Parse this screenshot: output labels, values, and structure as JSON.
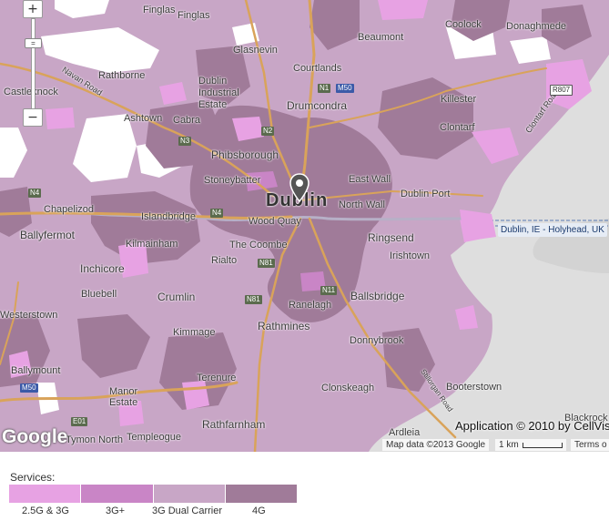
{
  "map": {
    "city_label": "Dublin",
    "districts": [
      "Finglas",
      "Finglas",
      "Beaumont",
      "Coolock",
      "Donaghmede",
      "Glasnevin",
      "Courtlands",
      "Dublin Industrial Estate",
      "Rathborne",
      "Navan Road",
      "Castleknock",
      "Ashtown",
      "Cabra",
      "Drumcondra",
      "Killester",
      "Clontarf Road",
      "Phibsborough",
      "Stoneybatter",
      "North Wall",
      "East Wall",
      "Dublin Port",
      "Chapelizod",
      "Islandbridge",
      "Wood Quay",
      "Kilmainham",
      "The Coombe",
      "Ringsend",
      "Ballyfermot",
      "Rialto",
      "Irishtown",
      "Inchicore",
      "Bluebell",
      "Crumlin",
      "Ranelagh",
      "Ballsbridge",
      "Rathmines",
      "Kimmage",
      "Donnybrook",
      "Westerstown",
      "Ballymount",
      "Terenure",
      "Manor Estate",
      "Clonskeagh",
      "Booterstown",
      "Rathfarnham",
      "Templeogue",
      "Tymon North",
      "Ardleia",
      "Blackrock",
      "Clontarf",
      "Stillorgan Road"
    ],
    "road_shields": [
      {
        "id": "N1",
        "kind": "n"
      },
      {
        "id": "M50",
        "kind": "m"
      },
      {
        "id": "R807",
        "kind": "r"
      },
      {
        "id": "N2",
        "kind": "n"
      },
      {
        "id": "N3",
        "kind": "n"
      },
      {
        "id": "N4",
        "kind": "n"
      },
      {
        "id": "N4",
        "kind": "n"
      },
      {
        "id": "N81",
        "kind": "n"
      },
      {
        "id": "N11",
        "kind": "n"
      },
      {
        "id": "N81",
        "kind": "n"
      },
      {
        "id": "M50",
        "kind": "m"
      },
      {
        "id": "E01",
        "kind": "n"
      }
    ],
    "ferry_label": "Dublin, IE - Holyhead, UK",
    "scale_label": "1 km",
    "map_data_attribution": "Map data ©2013 Google",
    "terms_label": "Terms o",
    "app_credit": "Application © 2010 by CellVision",
    "google_logo": "Google",
    "zoom_in_symbol": "+",
    "zoom_out_symbol": "−",
    "zoom_slider_symbol": "="
  },
  "legend": {
    "title": "Services:",
    "items": [
      {
        "label": "2.5G & 3G",
        "color": "#e7a2e3"
      },
      {
        "label": "3G+",
        "color": "#c985c6"
      },
      {
        "label": "3G Dual Carrier",
        "color": "#c8a6c6"
      },
      {
        "label": "4G",
        "color": "#a07b99"
      }
    ]
  },
  "colors": {
    "land": "#ebe7ea",
    "sea": "#dcdcdc",
    "coverage_3g_dual": "#c8a6c6",
    "coverage_4g": "#a07b99",
    "coverage_2g3g": "#e7a2e3",
    "road_major": "#d9a35a"
  }
}
